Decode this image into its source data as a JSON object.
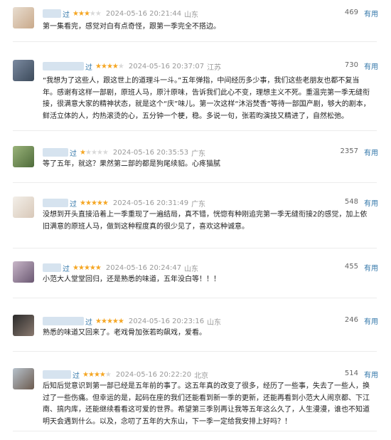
{
  "useful_label": "有用",
  "reviews": [
    {
      "username": "过",
      "rating": 3,
      "time": "2024-05-16 20:21:44",
      "location": "山东",
      "votes": "469",
      "content": "第一集看完，感觉对白有点奇怪，跟第一季完全不搭边。",
      "avatar_colors": [
        "#e8ddd0",
        "#c9a98a"
      ]
    },
    {
      "username": "过",
      "rating": 4,
      "time": "2024-05-16 20:37:07",
      "location": "江苏",
      "votes": "730",
      "content": "“我想为了这些人，跟这世上的道理斗一斗。”五年弹指，中间经历多少事，我们这些老朋友也都不复当年。感谢有这样一部剧，原班人马，原汁原味，告诉我们此心不变，理想主义不死。重温完第一季无缝衔接，很满意大家的精神状态，就是这个“庆”味儿。第一次这样“沐浴焚香”等待一部国产剧，够大的剧本，鲜活立体的人，灼热滚烫的心，五分钟一个梗，稳。多说一句，张若昀演技又精进了，自然松弛。",
      "avatar_colors": [
        "#7b8aa0",
        "#3c4a5a"
      ]
    },
    {
      "username": "过",
      "rating": 1,
      "time": "2024-05-16 20:35:53",
      "location": "广东",
      "votes": "2357",
      "content": "等了五年，就这？果然第二部的都是狗尾续貂。心疼猫腻",
      "avatar_colors": [
        "#9ab37a",
        "#4e6b3a"
      ]
    },
    {
      "username": "过",
      "rating": 5,
      "time": "2024-05-16 20:31:49",
      "location": "广东",
      "votes": "548",
      "content": "没想到开头直接沿着上一季重现了一遍结局，真不错，恍惚有种刚追完第一季无缝衔接2的感觉，加上依旧满意的原班人马，做到这种程度真的很少见了，喜欢这种诚意。",
      "avatar_colors": [
        "#f3efe9",
        "#d8c8b8"
      ]
    },
    {
      "username": "过",
      "rating": 5,
      "time": "2024-05-16 20:24:47",
      "location": "山东",
      "votes": "455",
      "content": "小范大人堂堂回归，还是熟悉的味道，五年没白等！！！",
      "avatar_colors": [
        "#c9b7c9",
        "#6a5872"
      ]
    },
    {
      "username": "过",
      "rating": 5,
      "time": "2024-05-16 20:23:16",
      "location": "山东",
      "votes": "246",
      "content": "熟悉的味道又回来了。老戏骨加张若昀飙戏，爱看。",
      "avatar_colors": [
        "#2a2a2a",
        "#8a7a70"
      ]
    },
    {
      "username": "过",
      "rating": 4,
      "time": "2024-05-16 20:22:20",
      "location": "北京",
      "votes": "514",
      "content": "后知后觉意识到第一部已经是五年前的事了。这五年真的改变了很多，经历了一些事，失去了一些人，换过了一些伤痛。但幸运的是，起码在座的我们还能看到新一季的更新，还能再看到小范大人闹京都、下江南、搞内库，还能继续看看这可爱的世界。希望第三季别再让我等五年这么久了，人生漫漫，谁也不知道明天会遇到什么。以及，念叨了五年的大东山，下一季一定给我安排上好吗？！",
      "avatar_colors": [
        "#b7c2cc",
        "#6b5a4e"
      ]
    }
  ]
}
